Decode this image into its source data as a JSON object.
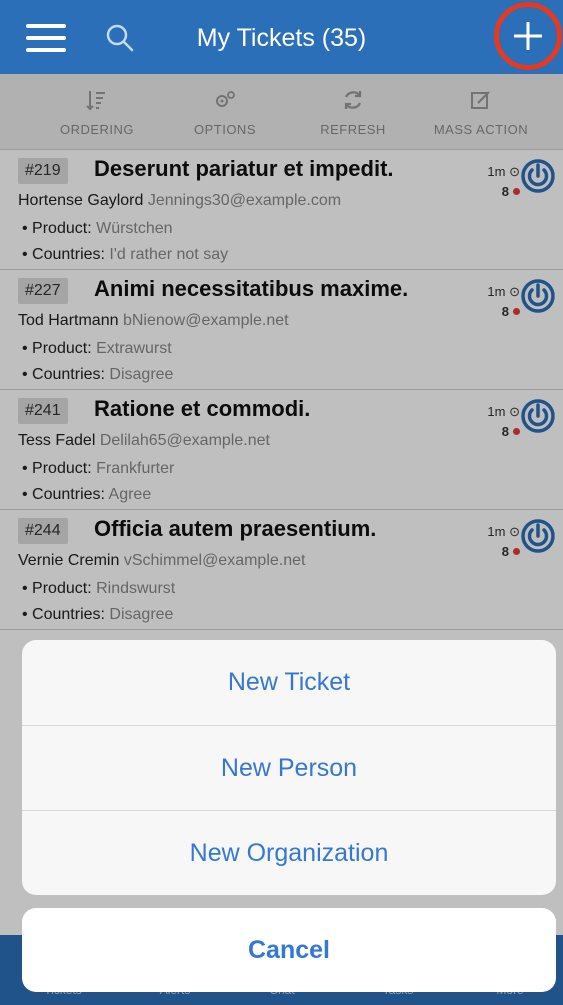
{
  "header": {
    "title": "My Tickets (35)",
    "menu_icon": "hamburger-icon",
    "search_icon": "search-icon",
    "add_icon": "plus-icon",
    "highlight_color": "#e53a1f",
    "bar_color": "#2a6fb7"
  },
  "toolbar": {
    "items": [
      {
        "label": "ORDERING",
        "icon": "sort-icon"
      },
      {
        "label": "OPTIONS",
        "icon": "gears-icon"
      },
      {
        "label": "REFRESH",
        "icon": "refresh-icon"
      },
      {
        "label": "MASS ACTION",
        "icon": "edit-icon"
      }
    ]
  },
  "tickets": [
    {
      "number": "#219",
      "subject": "Deserunt pariatur et impedit.",
      "person": "Hortense Gaylord",
      "email": "Jennings30@example.com",
      "product_label": "Product:",
      "product": "Würstchen",
      "countries_label": "Countries:",
      "countries": "I'd rather not say",
      "age": "1m",
      "count": "8"
    },
    {
      "number": "#227",
      "subject": "Animi necessitatibus maxime.",
      "person": "Tod Hartmann",
      "email": "bNienow@example.net",
      "product_label": "Product:",
      "product": "Extrawurst",
      "countries_label": "Countries:",
      "countries": "Disagree",
      "age": "1m",
      "count": "8"
    },
    {
      "number": "#241",
      "subject": "Ratione et commodi.",
      "person": "Tess Fadel",
      "email": "Delilah65@example.net",
      "product_label": "Product:",
      "product": "Frankfurter",
      "countries_label": "Countries:",
      "countries": "Agree",
      "age": "1m",
      "count": "8"
    },
    {
      "number": "#244",
      "subject": "Officia autem praesentium.",
      "person": "Vernie Cremin",
      "email": "vSchimmel@example.net",
      "product_label": "Product:",
      "product": "Rindswurst",
      "countries_label": "Countries:",
      "countries": "Disagree",
      "age": "1m",
      "count": "8"
    }
  ],
  "action_sheet": {
    "options": [
      "New Ticket",
      "New Person",
      "New Organization"
    ],
    "cancel": "Cancel",
    "color": "#3478d4"
  },
  "tabbar": {
    "tabs": [
      "Tickets",
      "Alerts",
      "Chat",
      "Tasks",
      "More"
    ]
  }
}
